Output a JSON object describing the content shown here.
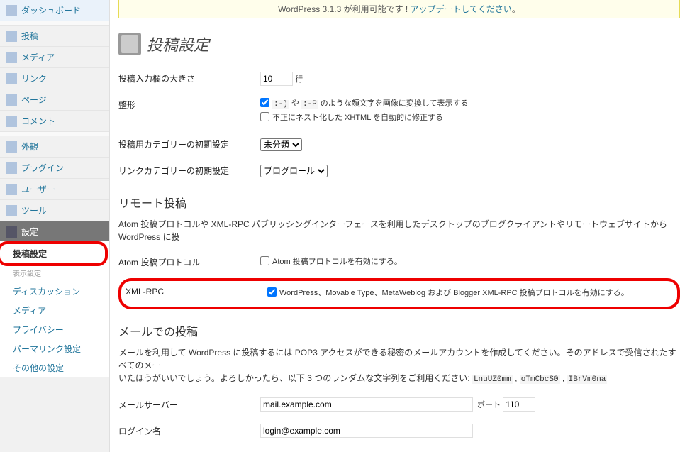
{
  "update_nag": {
    "prefix": "WordPress 3.1.3 が利用可能です ! ",
    "link": "アップデートしてください",
    "suffix": "。"
  },
  "sidebar": {
    "dashboard": "ダッシュボード",
    "posts": "投稿",
    "media": "メディア",
    "links": "リンク",
    "pages": "ページ",
    "comments": "コメント",
    "appearance": "外観",
    "plugins": "プラグイン",
    "users": "ユーザー",
    "tools": "ツール",
    "settings": "設定",
    "sub": {
      "writing": "投稿設定",
      "display_hidden": "表示設定",
      "discussion": "ディスカッション",
      "media": "メディア",
      "privacy": "プライバシー",
      "permalink": "パーマリンク設定",
      "other": "その他の設定"
    }
  },
  "page_title": "投稿設定",
  "form": {
    "textarea_size": {
      "label": "投稿入力欄の大きさ",
      "value": "10",
      "unit": "行"
    },
    "formatting": {
      "label": "整形",
      "emoticons_checked": true,
      "emoticons_code1": ":-)",
      "emoticons_mid": " や ",
      "emoticons_code2": ":-P",
      "emoticons_text": " のような顔文字を画像に変換して表示する",
      "xhtml_checked": false,
      "xhtml_text": "不正にネスト化した XHTML を自動的に修正する"
    },
    "default_cat": {
      "label": "投稿用カテゴリーの初期設定",
      "value": "未分類"
    },
    "default_link_cat": {
      "label": "リンクカテゴリーの初期設定",
      "value": "ブログロール"
    }
  },
  "remote": {
    "heading": "リモート投稿",
    "desc": "Atom 投稿プロトコルや XML-RPC パブリッシングインターフェースを利用したデスクトップのブログクライアントやリモートウェブサイトから WordPress に投",
    "atom": {
      "label": "Atom 投稿プロトコル",
      "checked": false,
      "text": "Atom 投稿プロトコルを有効にする。"
    },
    "xmlrpc": {
      "label": "XML-RPC",
      "checked": true,
      "text": "WordPress、Movable Type、MetaWeblog および Blogger XML-RPC 投稿プロトコルを有効にする。"
    }
  },
  "mail": {
    "heading": "メールでの投稿",
    "desc_a": "メールを利用して WordPress に投稿するには POP3 アクセスができる秘密のメールアカウントを作成してください。そのアドレスで受信されたすべてのメー",
    "desc_b": "いたほうがいいでしょう。よろしかったら、以下 3 つのランダムな文字列をご利用ください: ",
    "r1": "LnuUZ0mm",
    "comma": " , ",
    "r2": "oTmCbcS0",
    "r3": "IBrVm0na",
    "server": {
      "label": "メールサーバー",
      "value": "mail.example.com",
      "port_label": "ポート",
      "port_value": "110"
    },
    "login": {
      "label": "ログイン名",
      "value": "login@example.com"
    }
  }
}
